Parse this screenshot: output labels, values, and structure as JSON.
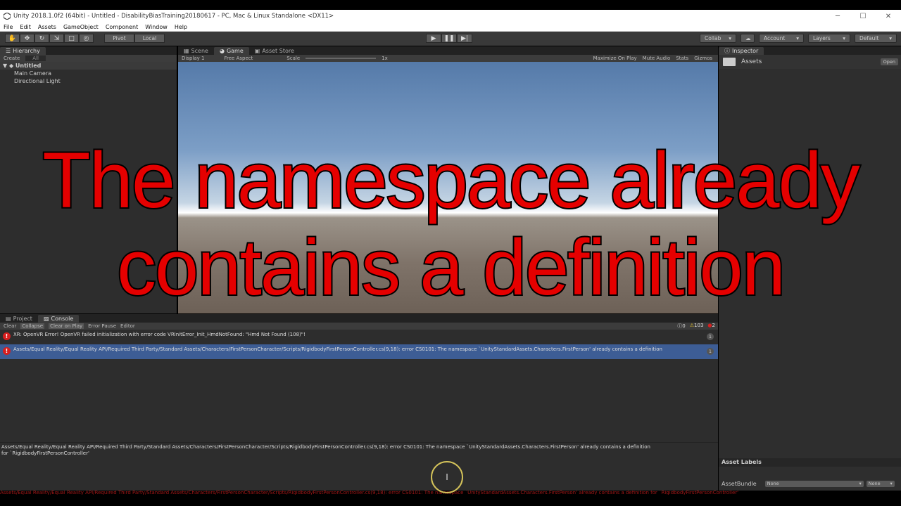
{
  "window": {
    "title": "Unity 2018.1.0f2 (64bit) - Untitled - DisabilityBiasTraining20180617 - PC, Mac & Linux Standalone <DX11>",
    "min": "─",
    "max": "☐",
    "close": "✕"
  },
  "menu": [
    "File",
    "Edit",
    "Assets",
    "GameObject",
    "Component",
    "Window",
    "Help"
  ],
  "toolbar": {
    "pivot": "Pivot",
    "local": "Local",
    "collab": "Collab",
    "account": "Account",
    "layers": "Layers",
    "layout": "Default"
  },
  "hierarchy": {
    "tab": "Hierarchy",
    "create": "Create",
    "search_placeholder": "All",
    "scene": "Untitled",
    "items": [
      "Main Camera",
      "Directional Light"
    ]
  },
  "game": {
    "tabs": [
      "Scene",
      "Game",
      "Asset Store"
    ],
    "display": "Display 1",
    "aspect": "Free Aspect",
    "scale_label": "Scale",
    "scale_value": "1x",
    "options": [
      "Maximize On Play",
      "Mute Audio",
      "Stats",
      "Gizmos"
    ]
  },
  "inspector": {
    "tab": "Inspector",
    "asset_name": "Assets",
    "open": "Open",
    "asset_labels": "Asset Labels",
    "asset_bundle": "AssetBundle",
    "bundle_value": "None",
    "variant_value": "None"
  },
  "console": {
    "tabs": [
      "Project",
      "Console"
    ],
    "buttons": [
      "Clear",
      "Collapse",
      "Clear on Play",
      "Error Pause",
      "Editor"
    ],
    "count_info": "0",
    "count_warn": "103",
    "count_err": "2",
    "logs": [
      {
        "text": "XR: OpenVR Error! OpenVR failed initialization with error code VRInitError_Init_HmdNotFound: \"Hmd Not Found (108)\"!",
        "count": "1"
      },
      {
        "text": "Assets/Equal Reality/Equal Reality API/Required Third Party/Standard Assets/Characters/FirstPersonCharacter/Scripts/RigidbodyFirstPersonController.cs(9,18): error CS0101: The namespace `UnityStandardAssets.Characters.FirstPerson' already contains a definition",
        "count": "1"
      }
    ],
    "detail_line1": "Assets/Equal Reality/Equal Reality API/Required Third Party/Standard Assets/Characters/FirstPersonCharacter/Scripts/RigidbodyFirstPersonController.cs(9,18): error CS0101: The namespace `UnityStandardAssets.Characters.FirstPerson' already contains a definition",
    "detail_line2": "for `RigidbodyFirstPersonController'"
  },
  "status_text": "Assets/Equal Reality/Equal Reality API/Required Third Party/Standard Assets/Characters/FirstPersonCharacter/Scripts/RigidbodyFirstPersonController.cs(9,18): error CS0101: The namespace `UnityStandardAssets.Characters.FirstPerson' already contains a definition for `RigidbodyFirstPersonController'",
  "overlay": {
    "line1": "The namespace already",
    "line2": "contains a definition"
  },
  "colors": {
    "overlay_text": "#e50000",
    "selected_row": "#3d5d95",
    "error": "#d71f1f"
  }
}
